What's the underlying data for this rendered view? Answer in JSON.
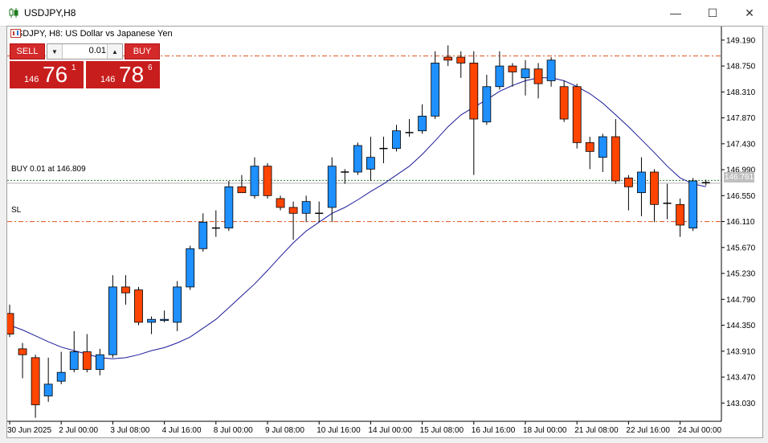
{
  "window": {
    "title": "USDJPY,H8",
    "minimize_icon": "minimize-icon",
    "maximize_icon": "maximize-icon",
    "close_icon": "close-icon"
  },
  "chart_header": {
    "symbol_text": "USDJPY, H8:  US Dollar vs Japanese Yen"
  },
  "trade_panel": {
    "sell_label": "SELL",
    "buy_label": "BUY",
    "lot_value": "0.01",
    "sell_price_small": "146",
    "sell_price_big": "76",
    "sell_price_sup": "1",
    "buy_price_small": "146",
    "buy_price_big": "78",
    "buy_price_sup": "6"
  },
  "levels": {
    "buy_label": "BUY 0.01 at 146.809",
    "sl_label": "SL",
    "current_price_tag": "146.761"
  },
  "colors": {
    "bull": "#1e90ff",
    "bear": "#ff4500",
    "ma": "#1a1a9a",
    "level_line": "#e0501a",
    "buy_line": "#2e7d32"
  },
  "chart_data": {
    "type": "candlestick",
    "y_ticks": [
      "149.190",
      "148.750",
      "148.310",
      "147.870",
      "147.430",
      "146.990",
      "146.550",
      "146.110",
      "145.670",
      "145.230",
      "144.790",
      "144.350",
      "143.910",
      "143.470",
      "143.030"
    ],
    "x_ticks": [
      "30 Jun 2025",
      "2 Jul 00:00",
      "3 Jul 08:00",
      "4 Jul 16:00",
      "8 Jul 00:00",
      "9 Jul 08:00",
      "10 Jul 16:00",
      "14 Jul 00:00",
      "15 Jul 08:00",
      "16 Jul 16:00",
      "18 Jul 00:00",
      "21 Jul 08:00",
      "22 Jul 16:00",
      "24 Jul 00:00"
    ],
    "ylim": [
      142.72,
      149.42
    ],
    "levels": {
      "sell_order_line": 148.92,
      "buy_entry": 146.809,
      "stop_loss": 146.11,
      "current": 146.761
    },
    "candles": [
      {
        "o": 144.55,
        "h": 144.7,
        "l": 144.15,
        "c": 144.2
      },
      {
        "o": 143.95,
        "h": 144.05,
        "l": 143.45,
        "c": 143.85
      },
      {
        "o": 143.8,
        "h": 143.85,
        "l": 142.78,
        "c": 143.0
      },
      {
        "o": 143.15,
        "h": 143.8,
        "l": 143.05,
        "c": 143.35
      },
      {
        "o": 143.4,
        "h": 143.9,
        "l": 143.35,
        "c": 143.55
      },
      {
        "o": 143.6,
        "h": 144.25,
        "l": 143.55,
        "c": 143.9
      },
      {
        "o": 143.9,
        "h": 144.2,
        "l": 143.55,
        "c": 143.6
      },
      {
        "o": 143.6,
        "h": 143.95,
        "l": 143.5,
        "c": 143.85
      },
      {
        "o": 143.85,
        "h": 145.2,
        "l": 143.8,
        "c": 145.0
      },
      {
        "o": 145.0,
        "h": 145.2,
        "l": 144.7,
        "c": 144.9
      },
      {
        "o": 144.95,
        "h": 145.0,
        "l": 144.35,
        "c": 144.4
      },
      {
        "o": 144.4,
        "h": 144.5,
        "l": 144.2,
        "c": 144.45
      },
      {
        "o": 144.43,
        "h": 144.6,
        "l": 144.4,
        "c": 144.45
      },
      {
        "o": 144.4,
        "h": 145.1,
        "l": 144.25,
        "c": 145.0
      },
      {
        "o": 145.0,
        "h": 145.7,
        "l": 144.95,
        "c": 145.65
      },
      {
        "o": 145.65,
        "h": 146.25,
        "l": 145.6,
        "c": 146.1
      },
      {
        "o": 146.0,
        "h": 146.3,
        "l": 145.85,
        "c": 146.0
      },
      {
        "o": 146.0,
        "h": 146.8,
        "l": 145.95,
        "c": 146.7
      },
      {
        "o": 146.7,
        "h": 146.9,
        "l": 146.6,
        "c": 146.6
      },
      {
        "o": 146.55,
        "h": 147.2,
        "l": 146.5,
        "c": 147.05
      },
      {
        "o": 147.05,
        "h": 147.1,
        "l": 146.5,
        "c": 146.55
      },
      {
        "o": 146.5,
        "h": 146.55,
        "l": 146.3,
        "c": 146.35
      },
      {
        "o": 146.35,
        "h": 146.45,
        "l": 145.8,
        "c": 146.25
      },
      {
        "o": 146.25,
        "h": 146.55,
        "l": 146.1,
        "c": 146.45
      },
      {
        "o": 146.25,
        "h": 146.45,
        "l": 146.1,
        "c": 146.25
      },
      {
        "o": 146.35,
        "h": 147.2,
        "l": 146.1,
        "c": 147.05
      },
      {
        "o": 146.95,
        "h": 147.0,
        "l": 146.75,
        "c": 146.95
      },
      {
        "o": 146.95,
        "h": 147.45,
        "l": 146.9,
        "c": 147.4
      },
      {
        "o": 147.0,
        "h": 147.55,
        "l": 146.8,
        "c": 147.2
      },
      {
        "o": 147.35,
        "h": 147.55,
        "l": 147.1,
        "c": 147.35
      },
      {
        "o": 147.35,
        "h": 147.75,
        "l": 147.3,
        "c": 147.65
      },
      {
        "o": 147.62,
        "h": 147.85,
        "l": 147.55,
        "c": 147.62
      },
      {
        "o": 147.65,
        "h": 148.1,
        "l": 147.6,
        "c": 147.9
      },
      {
        "o": 147.9,
        "h": 149.0,
        "l": 147.85,
        "c": 148.8
      },
      {
        "o": 148.9,
        "h": 149.1,
        "l": 148.75,
        "c": 148.85
      },
      {
        "o": 148.9,
        "h": 149.0,
        "l": 148.55,
        "c": 148.8
      },
      {
        "o": 148.8,
        "h": 149.0,
        "l": 146.9,
        "c": 147.85
      },
      {
        "o": 147.8,
        "h": 148.6,
        "l": 147.75,
        "c": 148.4
      },
      {
        "o": 148.4,
        "h": 149.0,
        "l": 148.35,
        "c": 148.75
      },
      {
        "o": 148.75,
        "h": 148.8,
        "l": 148.4,
        "c": 148.65
      },
      {
        "o": 148.55,
        "h": 148.85,
        "l": 148.25,
        "c": 148.7
      },
      {
        "o": 148.7,
        "h": 148.8,
        "l": 148.2,
        "c": 148.45
      },
      {
        "o": 148.5,
        "h": 148.9,
        "l": 148.4,
        "c": 148.85
      },
      {
        "o": 148.4,
        "h": 148.5,
        "l": 147.8,
        "c": 147.85
      },
      {
        "o": 148.4,
        "h": 148.45,
        "l": 147.35,
        "c": 147.45
      },
      {
        "o": 147.45,
        "h": 147.55,
        "l": 147.0,
        "c": 147.3
      },
      {
        "o": 147.2,
        "h": 147.6,
        "l": 146.95,
        "c": 147.55
      },
      {
        "o": 147.55,
        "h": 147.85,
        "l": 146.75,
        "c": 146.8
      },
      {
        "o": 146.85,
        "h": 146.9,
        "l": 146.3,
        "c": 146.7
      },
      {
        "o": 146.6,
        "h": 147.2,
        "l": 146.2,
        "c": 146.95
      },
      {
        "o": 146.95,
        "h": 147.0,
        "l": 146.1,
        "c": 146.4
      },
      {
        "o": 146.42,
        "h": 146.75,
        "l": 146.15,
        "c": 146.42
      },
      {
        "o": 146.4,
        "h": 146.5,
        "l": 145.85,
        "c": 146.05
      },
      {
        "o": 146.0,
        "h": 146.85,
        "l": 145.95,
        "c": 146.8
      },
      {
        "o": 146.77,
        "h": 146.82,
        "l": 146.72,
        "c": 146.78
      }
    ],
    "ma": [
      144.35,
      144.27,
      144.17,
      144.07,
      143.98,
      143.92,
      143.86,
      143.8,
      143.78,
      143.8,
      143.85,
      143.92,
      143.97,
      144.05,
      144.15,
      144.3,
      144.45,
      144.65,
      144.85,
      145.05,
      145.28,
      145.52,
      145.75,
      145.95,
      146.1,
      146.25,
      146.35,
      146.48,
      146.62,
      146.75,
      146.9,
      147.05,
      147.25,
      147.48,
      147.72,
      147.92,
      148.05,
      148.18,
      148.32,
      148.42,
      148.5,
      148.55,
      148.55,
      148.5,
      148.4,
      148.28,
      148.12,
      147.92,
      147.72,
      147.5,
      147.28,
      147.05,
      146.85,
      146.75,
      146.7
    ]
  }
}
